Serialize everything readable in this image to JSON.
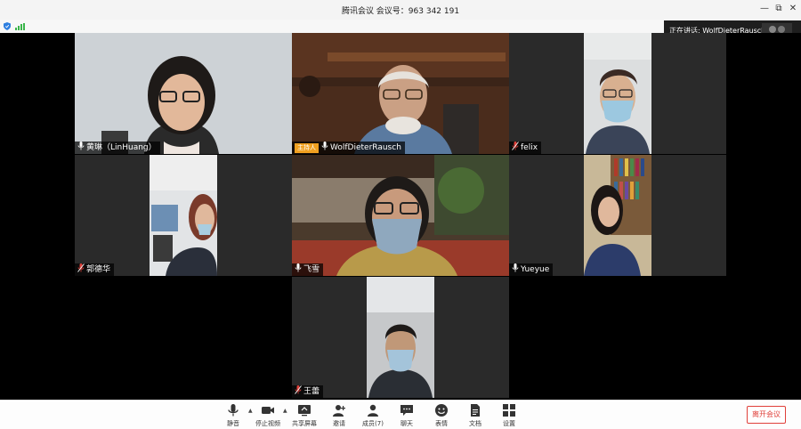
{
  "window": {
    "title": "腾讯会议  会议号：963 342 191",
    "minimize": "—",
    "restore": "⧉",
    "close": "✕"
  },
  "speaking_indicator": "正在讲话: WolfDieterRausch;",
  "host_badge": "主持人",
  "participants": [
    {
      "name": "黄琳（LinHuang）",
      "mic": "on"
    },
    {
      "name": "WolfDieterRausch",
      "mic": "on",
      "host": true
    },
    {
      "name": "felix",
      "mic": "muted"
    },
    {
      "name": "郭德华",
      "mic": "muted"
    },
    {
      "name": "飞雪",
      "mic": "on"
    },
    {
      "name": "Yueyue",
      "mic": "on"
    },
    {
      "name": "王蕾",
      "mic": "muted"
    }
  ],
  "toolbar": {
    "mute": "静音",
    "stop_video": "停止视频",
    "share_screen": "共享屏幕",
    "invite": "邀请",
    "members": "成员(7)",
    "chat": "聊天",
    "reactions": "表情",
    "documents": "文档",
    "settings": "设置",
    "leave": "离开会议"
  },
  "colors": {
    "leave": "#e0403a",
    "host_badge": "#f0a020",
    "muted_mic": "#e0403a",
    "signal": "#3ab54a",
    "shield": "#2f7fe0"
  }
}
